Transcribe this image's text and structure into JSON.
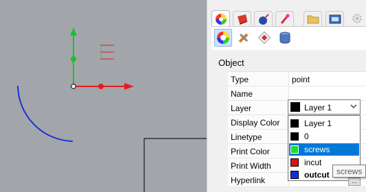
{
  "viewport": {
    "colors": {
      "background": "#a2a6ab",
      "y_axis": "#17c22b",
      "x_axis": "#e31c1c",
      "arc": "#1d2fd6",
      "origin": "#ffffff"
    }
  },
  "panel_tabs": [
    {
      "icon": "color-wheel-icon"
    },
    {
      "icon": "material-ball-icon"
    },
    {
      "icon": "bomb-icon"
    },
    {
      "icon": "lamp-icon"
    },
    {
      "icon": "folder-icon"
    },
    {
      "icon": "named-view-icon"
    },
    {
      "icon": "gear-icon"
    }
  ],
  "toolbar": [
    {
      "icon": "object-properties-icon"
    },
    {
      "icon": "wrench-pencil-icon"
    },
    {
      "icon": "texture-mapping-icon"
    },
    {
      "icon": "database-icon"
    }
  ],
  "section_title": "Object",
  "properties": [
    {
      "label": "Type",
      "value": "point"
    },
    {
      "label": "Name",
      "value": ""
    },
    {
      "label": "Layer",
      "value": ""
    },
    {
      "label": "Display Color",
      "value": ""
    },
    {
      "label": "Linetype",
      "value": ""
    },
    {
      "label": "Print Color",
      "value": ""
    },
    {
      "label": "Print Width",
      "value": ""
    },
    {
      "label": "Hyperlink",
      "value": ""
    }
  ],
  "layer_combo": {
    "selected": "Layer 1",
    "swatch": "#000000"
  },
  "layer_options": [
    {
      "name": "Layer 1",
      "color": "#000000",
      "selected": false,
      "current": false
    },
    {
      "name": "0",
      "color": "#000000",
      "selected": false,
      "current": false
    },
    {
      "name": "screws",
      "color": "#22dd22",
      "selected": true,
      "current": false
    },
    {
      "name": "incut",
      "color": "#e01010",
      "selected": false,
      "current": false
    },
    {
      "name": "outcut",
      "color": "#1030e0",
      "selected": false,
      "current": true
    }
  ],
  "tooltip": "screws",
  "hyperlink_button": "..."
}
